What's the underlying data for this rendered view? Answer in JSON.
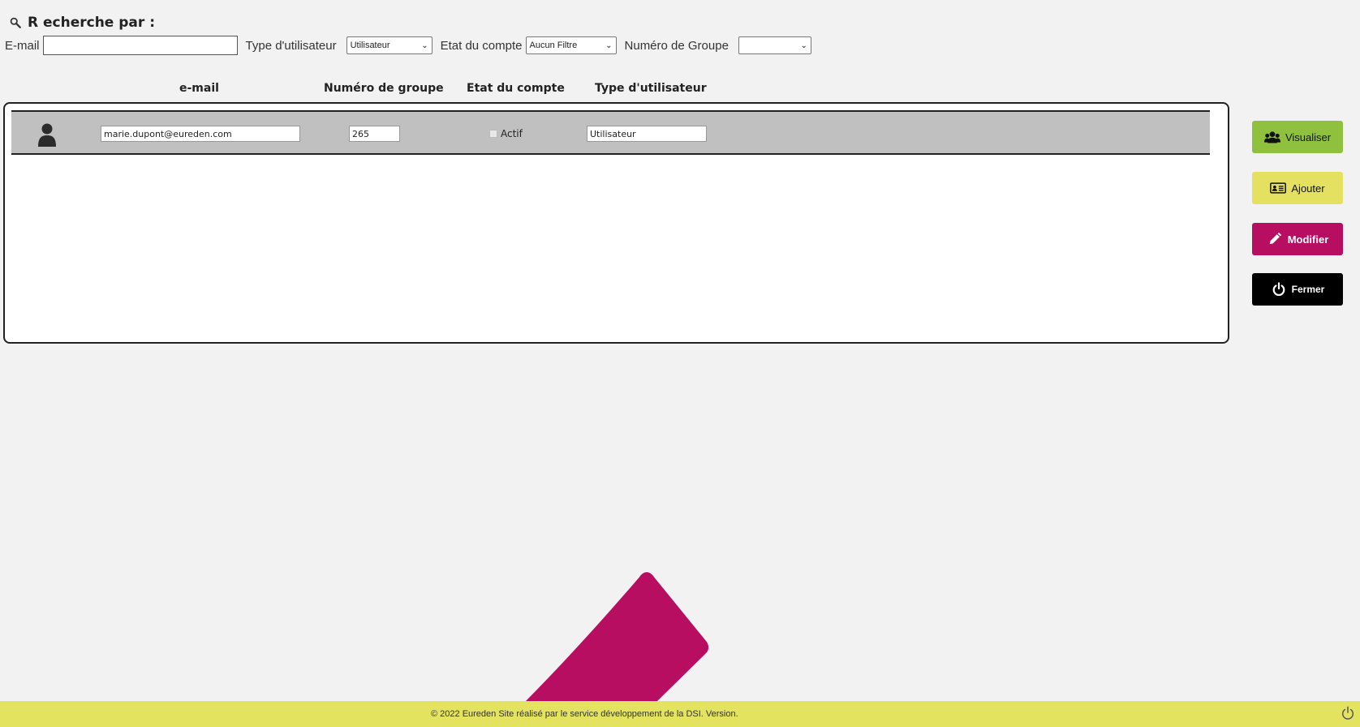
{
  "search": {
    "title": "R echerche par :",
    "email_label": "E-mail",
    "email_value": "",
    "user_type_label": "Type d'utilisateur",
    "user_type_selected": "Utilisateur",
    "account_state_label": "Etat du compte",
    "account_state_selected": "Aucun Filtre",
    "group_number_label": "Numéro de Groupe",
    "group_number_selected": ""
  },
  "table": {
    "headers": {
      "email": "e-mail",
      "group": "Numéro de groupe",
      "state": "Etat du compte",
      "type": "Type d'utilisateur"
    },
    "rows": [
      {
        "email": "marie.dupont@eureden.com",
        "group": "265",
        "active_label": "Actif",
        "active_checked": false,
        "type": "Utilisateur"
      }
    ]
  },
  "actions": {
    "view_label": "Visualiser",
    "add_label": "Ajouter",
    "edit_label": "Modifier",
    "close_label": "Fermer"
  },
  "colors": {
    "view": "#8fc13e",
    "add": "#e4e060",
    "edit": "#b70e62",
    "close": "#000000",
    "footer": "#e4e360",
    "row": "#c0c0c0"
  },
  "footer": {
    "copyright": "© 2022 Eureden Site réalisé par le service développement de la DSI. Version."
  }
}
